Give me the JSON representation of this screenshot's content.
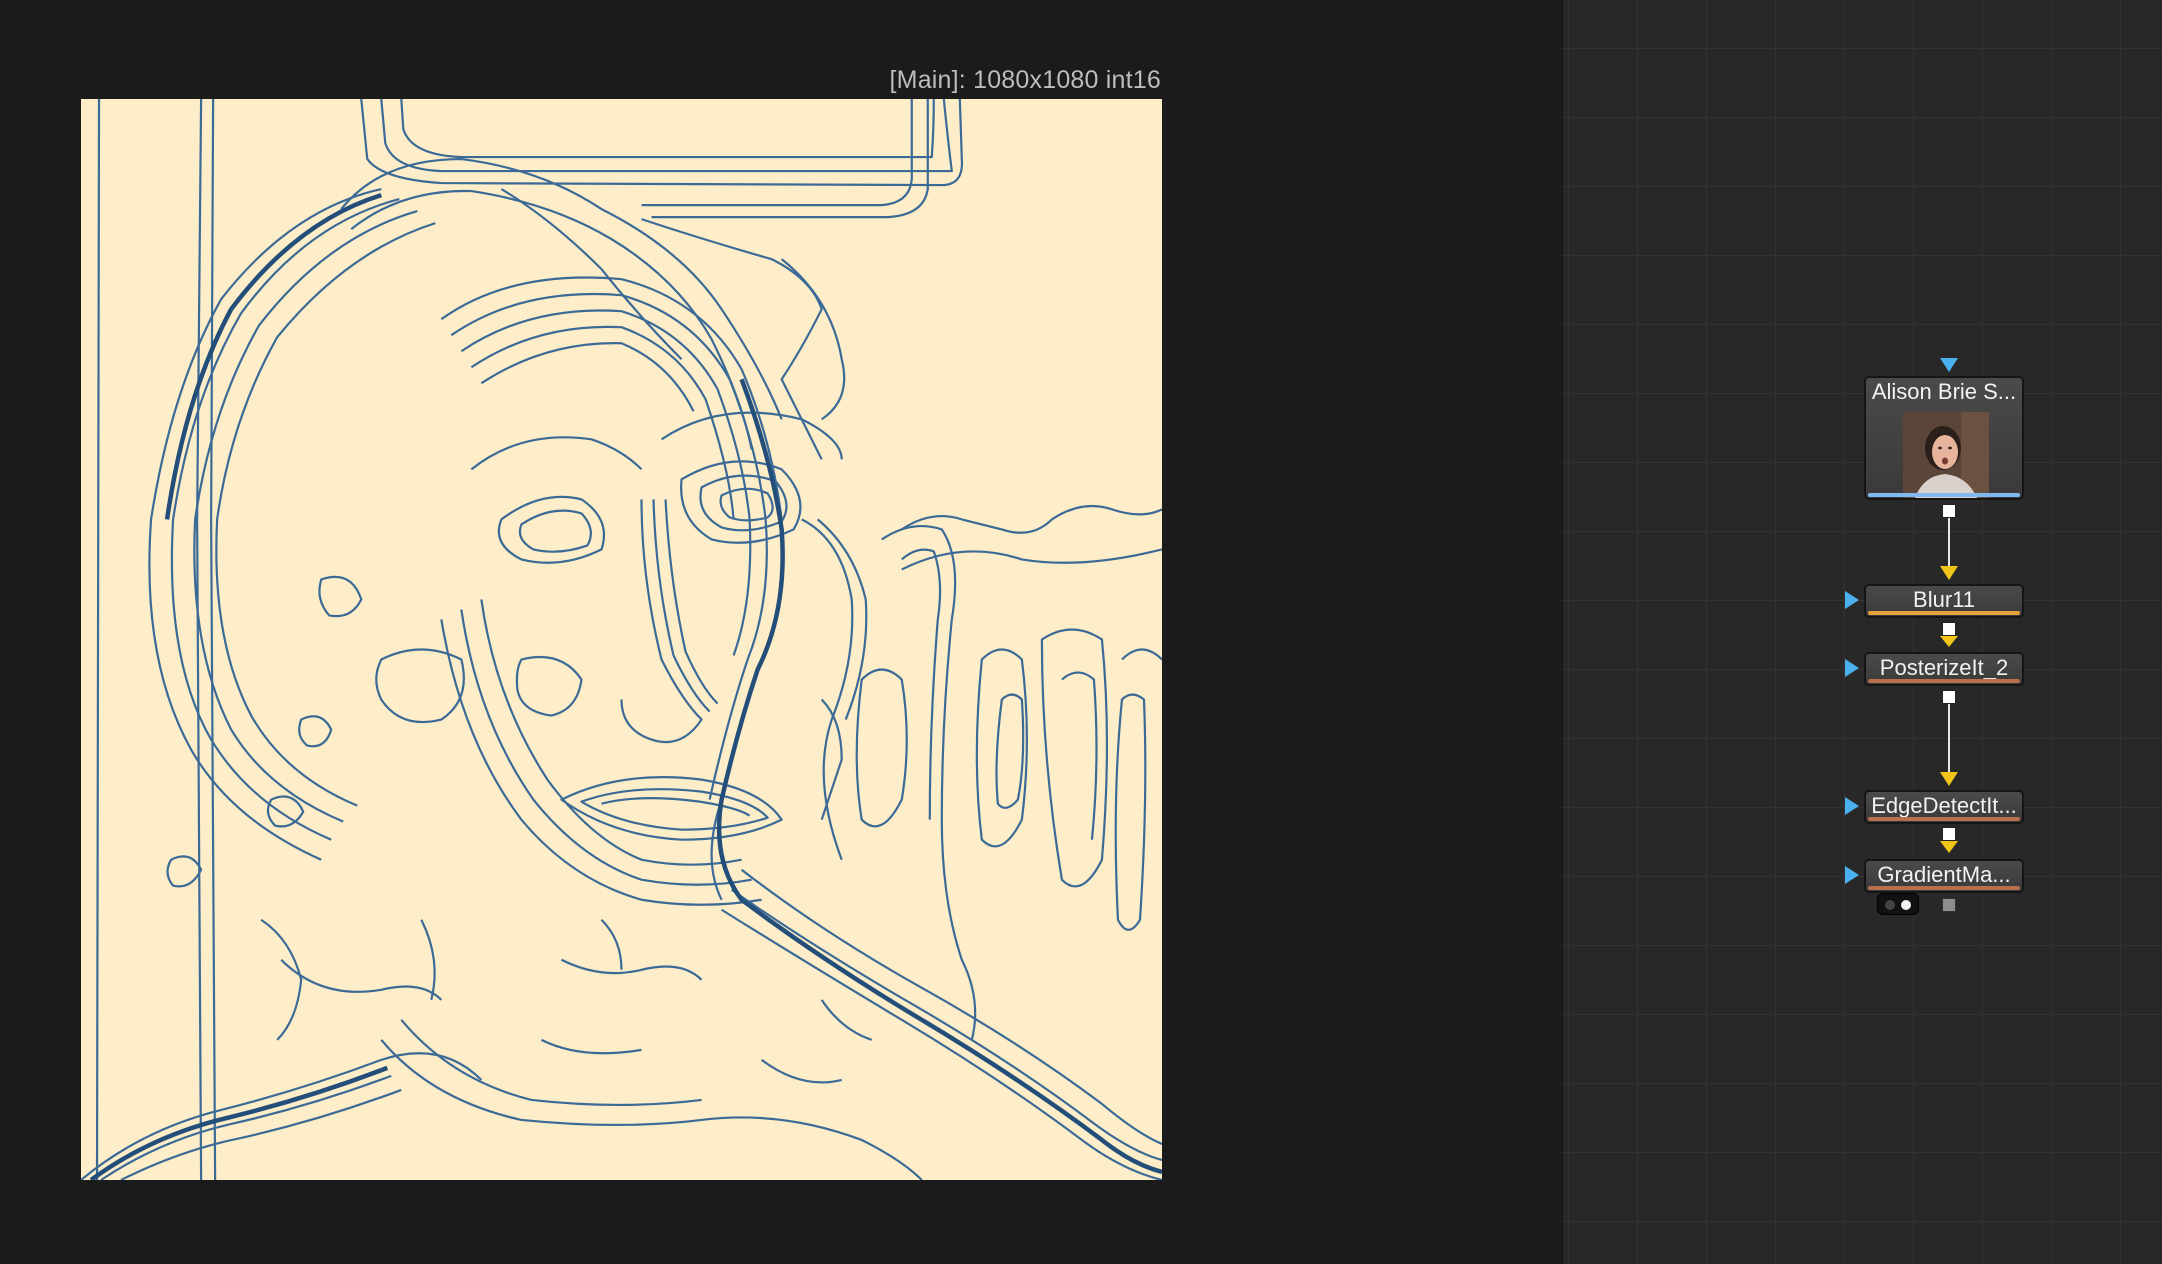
{
  "viewer": {
    "info": "[Main]: 1080x1080 int16",
    "background_color": "#fdeec9",
    "line_color": "#2c5a86"
  },
  "flow": {
    "nodes": [
      {
        "id": "loader",
        "label": "Alison Brie S...",
        "bar_color": "#7fb9ef",
        "icon": "image-thumbnail"
      },
      {
        "id": "blur",
        "label": "Blur11",
        "bar_color": "#e8a33c"
      },
      {
        "id": "posterize",
        "label": "PosterizeIt_2",
        "bar_color": "#b8704c"
      },
      {
        "id": "edge",
        "label": "EdgeDetectIt...",
        "bar_color": "#b8704c"
      },
      {
        "id": "gradient",
        "label": "GradientMa...",
        "bar_color": "#b8704c"
      }
    ],
    "colors": {
      "input_arrow": "#4ab0ee",
      "mask_arrow": "#f0c419",
      "output_square": "#ffffff"
    }
  }
}
